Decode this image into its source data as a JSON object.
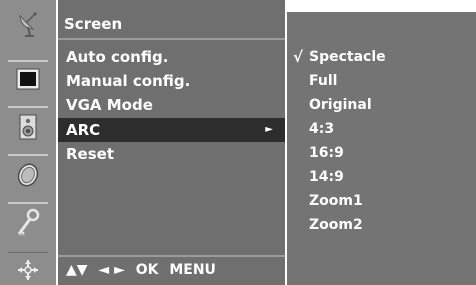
{
  "menu": {
    "title": "Screen",
    "items": [
      {
        "label": "Auto config."
      },
      {
        "label": "Manual config."
      },
      {
        "label": "VGA Mode"
      },
      {
        "label": "ARC",
        "arrow": "►"
      },
      {
        "label": "Reset"
      }
    ],
    "nav_hint": {
      "updown": "▲▼",
      "leftright": "◄ ►",
      "ok": "OK",
      "menu": "MENU"
    }
  },
  "submenu": {
    "check_mark": "√",
    "items": [
      {
        "label": "Spectacle",
        "selected": true
      },
      {
        "label": "Full"
      },
      {
        "label": "Original"
      },
      {
        "label": "4:3"
      },
      {
        "label": "16:9"
      },
      {
        "label": "14:9"
      },
      {
        "label": "Zoom1"
      },
      {
        "label": "Zoom2"
      }
    ]
  },
  "icons": [
    "satellite-dish-icon",
    "screen-icon",
    "speaker-icon",
    "clock-icon",
    "key-icon",
    "joystick-icon"
  ],
  "colors": {
    "strip": "#8d8d8d",
    "panel": "#6f6f6f",
    "highlight": "#2d2d2d",
    "submenu": "#747474"
  }
}
